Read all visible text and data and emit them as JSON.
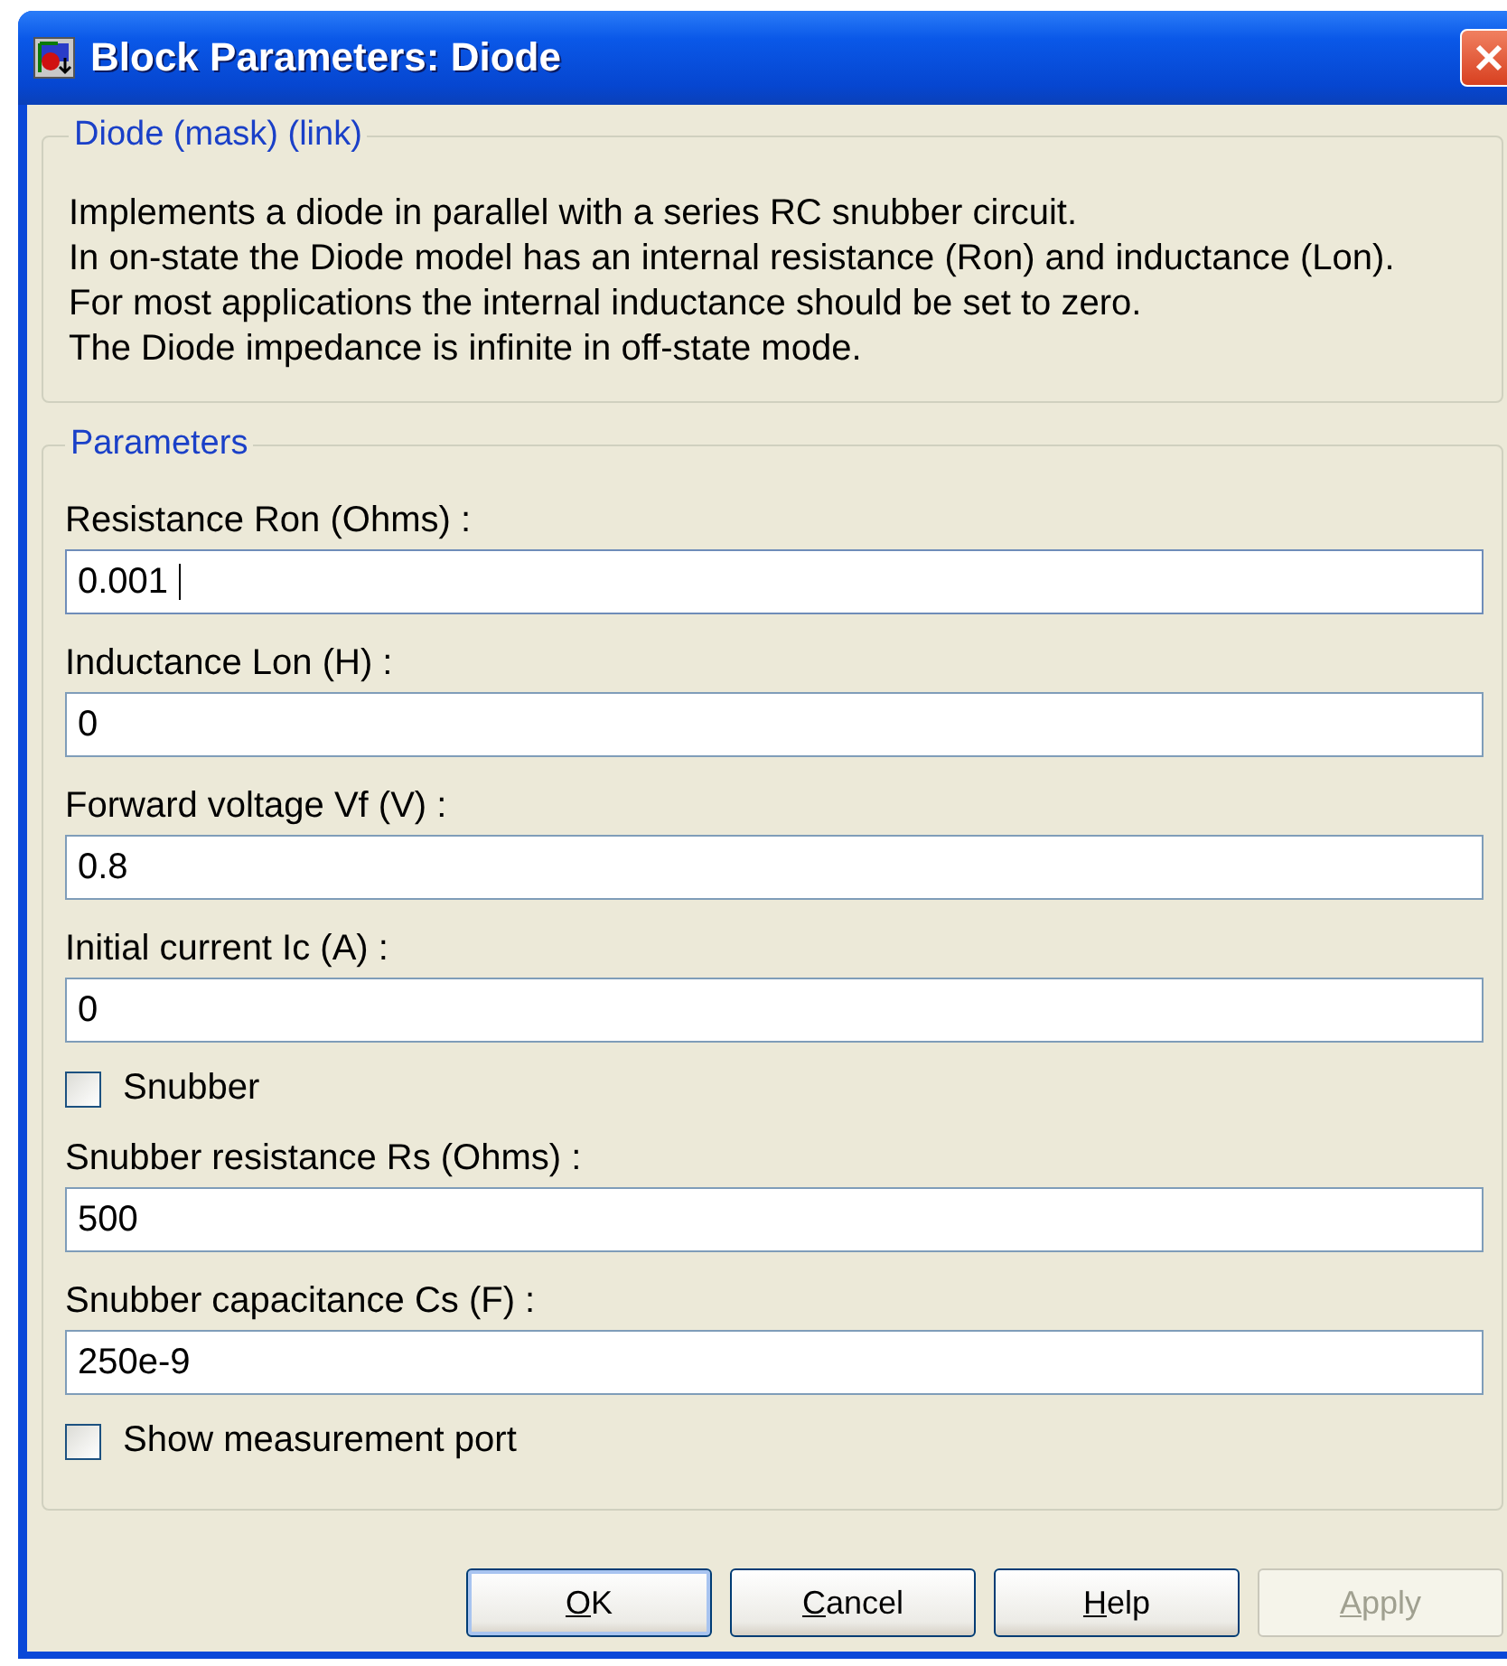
{
  "window": {
    "title": "Block Parameters: Diode"
  },
  "description": {
    "legend": "Diode (mask) (link)",
    "lines": [
      "Implements a diode in parallel with a series RC snubber circuit.",
      "In on-state the Diode model has an internal resistance (Ron) and inductance (Lon).",
      "For most applications the internal inductance should be set to zero.",
      "The Diode impedance is infinite in off-state mode."
    ]
  },
  "parameters": {
    "legend": "Parameters",
    "items": [
      {
        "kind": "field",
        "label": "Resistance Ron (Ohms) :",
        "value": "0.001",
        "focused": true
      },
      {
        "kind": "field",
        "label": "Inductance Lon (H) :",
        "value": "0",
        "focused": false
      },
      {
        "kind": "field",
        "label": "Forward voltage Vf (V) :",
        "value": "0.8",
        "focused": false
      },
      {
        "kind": "field",
        "label": "Initial current Ic (A) :",
        "value": "0",
        "focused": false
      },
      {
        "kind": "checkbox",
        "label": "Snubber",
        "checked": false
      },
      {
        "kind": "field",
        "label": "Snubber resistance Rs (Ohms) :",
        "value": "500",
        "focused": false
      },
      {
        "kind": "field",
        "label": "Snubber capacitance Cs (F) :",
        "value": "250e-9",
        "focused": false
      },
      {
        "kind": "checkbox",
        "label": "Show measurement port",
        "checked": false
      }
    ]
  },
  "buttons": [
    {
      "label": "OK",
      "first_letter_underlined": true,
      "default": true,
      "disabled": false
    },
    {
      "label": "Cancel",
      "first_letter_underlined": true,
      "default": false,
      "disabled": false
    },
    {
      "label": "Help",
      "first_letter_underlined": true,
      "default": false,
      "disabled": false
    },
    {
      "label": "Apply",
      "first_letter_underlined": true,
      "default": false,
      "disabled": true
    }
  ]
}
